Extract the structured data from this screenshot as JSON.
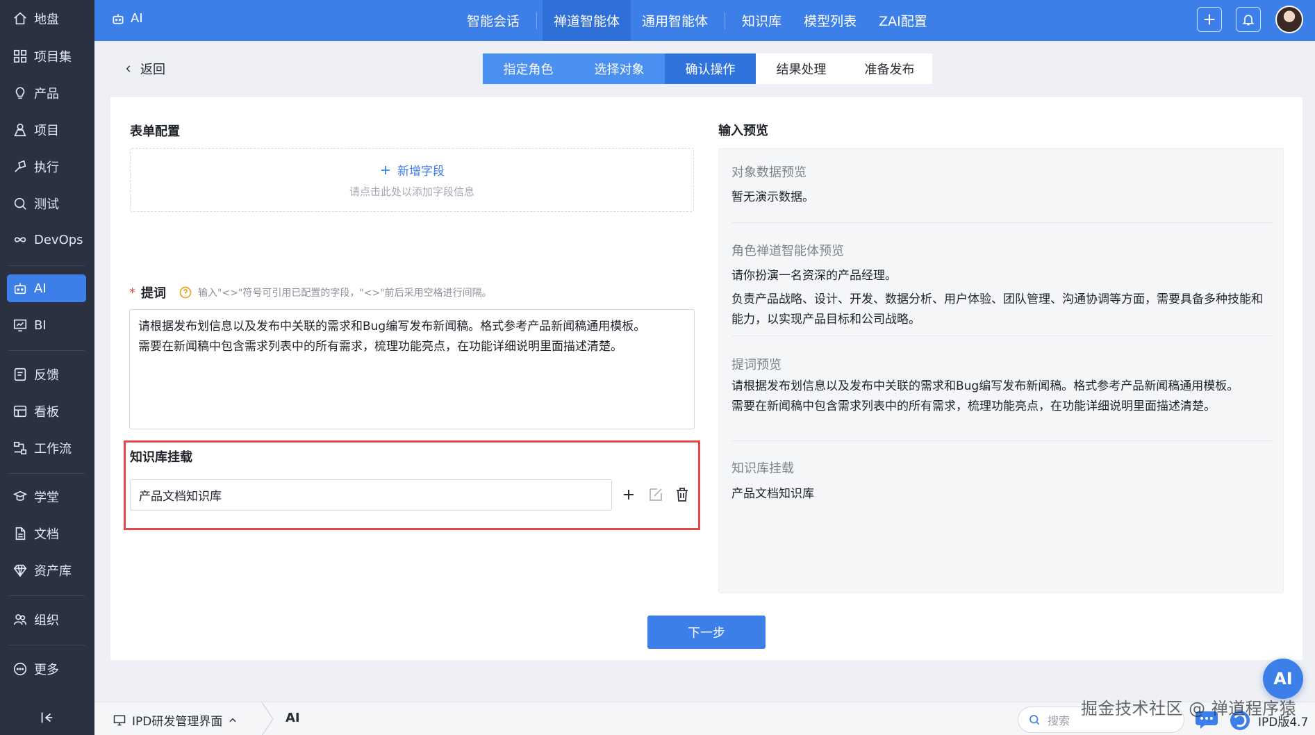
{
  "sidebar": {
    "items": [
      {
        "label": "地盘",
        "icon": "home-icon"
      },
      {
        "label": "项目集",
        "icon": "grid-icon"
      },
      {
        "label": "产品",
        "icon": "lightbulb-icon"
      },
      {
        "label": "项目",
        "icon": "person-icon"
      },
      {
        "label": "执行",
        "icon": "run-icon"
      },
      {
        "label": "测试",
        "icon": "search-icon"
      },
      {
        "label": "DevOps",
        "icon": "infinity-icon"
      },
      {
        "label": "AI",
        "icon": "robot-icon",
        "active": true
      },
      {
        "label": "BI",
        "icon": "chart-icon"
      },
      {
        "label": "反馈",
        "icon": "feedback-icon"
      },
      {
        "label": "看板",
        "icon": "kanban-icon"
      },
      {
        "label": "工作流",
        "icon": "workflow-icon"
      },
      {
        "label": "学堂",
        "icon": "learn-icon"
      },
      {
        "label": "文档",
        "icon": "document-icon"
      },
      {
        "label": "资产库",
        "icon": "diamond-icon"
      },
      {
        "label": "组织",
        "icon": "people-icon"
      },
      {
        "label": "更多",
        "icon": "more-icon"
      }
    ]
  },
  "topbar": {
    "app_title": "AI",
    "nav": [
      "智能会话",
      "禅道智能体",
      "通用智能体",
      "知识库",
      "模型列表",
      "ZAI配置"
    ],
    "active_nav": "禅道智能体"
  },
  "subheader": {
    "back_label": "返回",
    "steps": [
      {
        "label": "指定角色",
        "state": "done"
      },
      {
        "label": "选择对象",
        "state": "done"
      },
      {
        "label": "确认操作",
        "state": "current"
      },
      {
        "label": "结果处理",
        "state": "todo"
      },
      {
        "label": "准备发布",
        "state": "todo"
      }
    ]
  },
  "form": {
    "title": "表单配置",
    "add_field_label": "新增字段",
    "add_field_hint": "请点击此处以添加字段信息",
    "prompt_label": "提词",
    "prompt_hint": "输入\"<>\"符号可引用已配置的字段，\"<>\"前后采用空格进行间隔。",
    "prompt_line1": "请根据发布划信息以及发布中关联的需求和Bug编写发布新闻稿。格式参考产品新闻稿通用模板。",
    "prompt_line2": "需要在新闻稿中包含需求列表中的所有需求，梳理功能亮点，在功能详细说明里面描述清楚。",
    "kb_title": "知识库挂载",
    "kb_value": "产品文档知识库"
  },
  "preview": {
    "title": "输入预览",
    "object_title": "对象数据预览",
    "object_text": "暂无演示数据。",
    "role_title": "角色禅道智能体预览",
    "role_line1": "请你扮演一名资深的产品经理。",
    "role_line2": "负责产品战略、设计、开发、数据分析、用户体验、团队管理、沟通协调等方面，需要具备多种技能和能力，以实现产品目标和公司战略。",
    "prompt_title": "提词预览",
    "prompt_line1": "请根据发布划信息以及发布中关联的需求和Bug编写发布新闻稿。格式参考产品新闻稿通用模板。",
    "prompt_line2": "需要在新闻稿中包含需求列表中的所有需求，梳理功能亮点，在功能详细说明里面描述清楚。",
    "kb_title": "知识库挂载",
    "kb_text": "产品文档知识库"
  },
  "next_button": "下一步",
  "footer": {
    "workspace": "IPD研发管理界面",
    "app": "AI",
    "search_placeholder": "搜索",
    "version": "IPD版4.7"
  },
  "watermark": "掘金技术社区 @ 禅道程序猿",
  "ai_fab": "AI",
  "colors": {
    "accent": "#3d7fe8",
    "sidebar": "#2b3140",
    "highlight": "#e54848"
  }
}
